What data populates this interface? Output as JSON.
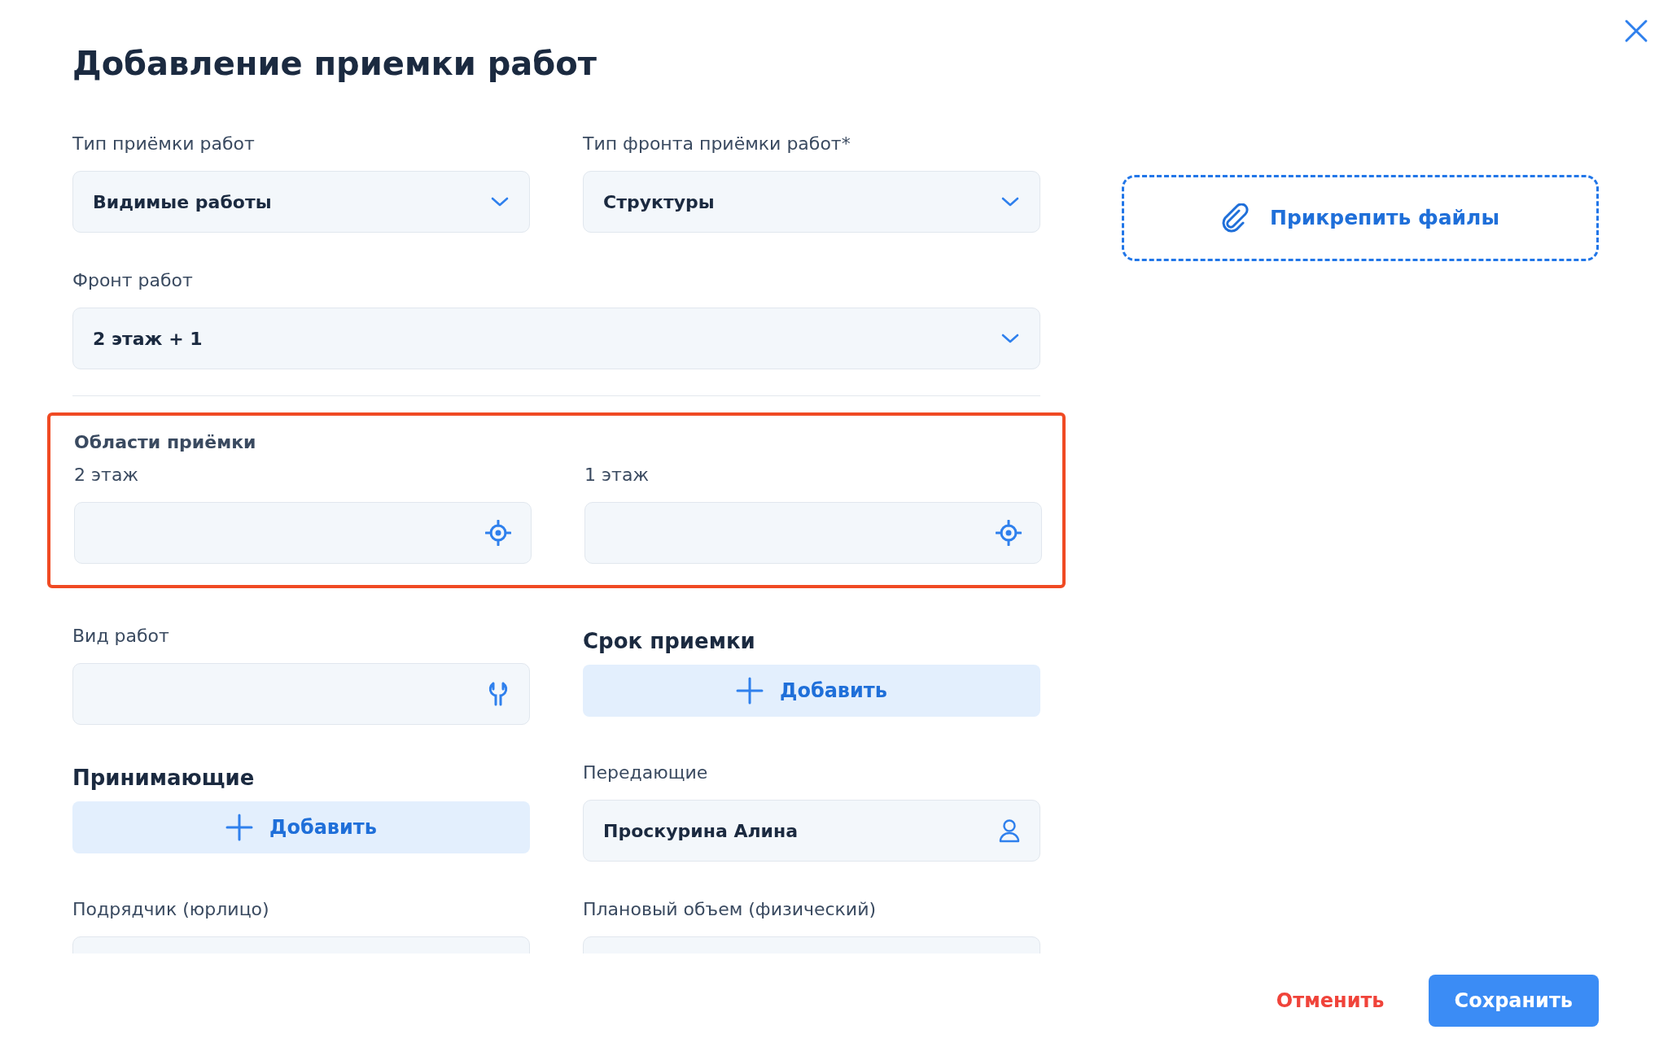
{
  "title": "Добавление приемки работ",
  "attach": {
    "label": "Прикрепить файлы"
  },
  "rows": [
    [
      {
        "kind": "select",
        "label": "Тип приёмки работ",
        "value": "Видимые работы"
      },
      {
        "kind": "select",
        "label": "Тип фронта приёмки работ*",
        "value": "Структуры"
      }
    ],
    [
      {
        "kind": "select",
        "label": "Фронт работ",
        "value": "2 этаж + 1",
        "wide": true
      }
    ]
  ],
  "areas": {
    "title": "Области приёмки",
    "highlighted": true,
    "fields": [
      {
        "kind": "locate",
        "label": "2 этаж"
      },
      {
        "kind": "locate",
        "label": "1 этаж"
      }
    ]
  },
  "rows2": [
    [
      {
        "kind": "tool",
        "label": "Вид работ"
      },
      {
        "kind": "add",
        "label": "Срок приемки",
        "button": "Добавить"
      }
    ],
    [
      {
        "kind": "add",
        "label": "Принимающие",
        "button": "Добавить"
      },
      {
        "kind": "person",
        "label": "Передающие",
        "value": "Проскурина Алина"
      }
    ],
    [
      {
        "kind": "input",
        "label": "Подрядчик (юрлицо)"
      },
      {
        "kind": "input",
        "label": "Плановый объем (физический)"
      }
    ]
  ],
  "footer": {
    "cancel": "Отменить",
    "save": "Сохранить"
  }
}
